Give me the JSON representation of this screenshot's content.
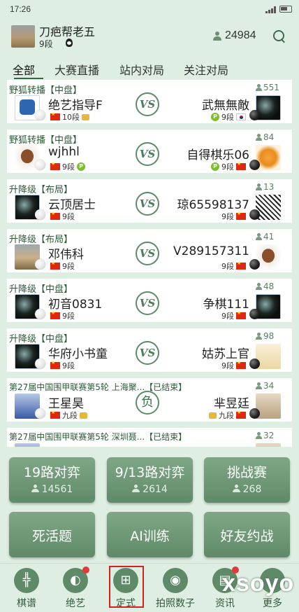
{
  "status_bar": {
    "time": "17:26"
  },
  "header": {
    "username": "刀疤帮老五",
    "rank": "9段",
    "online_count": "24984"
  },
  "tabs": [
    "全部",
    "大赛直播",
    "站内对局",
    "关注对局"
  ],
  "matches": [
    {
      "title": "野狐转播【中盘】",
      "viewers": "551",
      "left_name": "绝艺指导F",
      "left_rank": "10段",
      "right_name": "武無無敵",
      "right_rank": "9段"
    },
    {
      "title": "野狐转播【中盘】",
      "viewers": "84",
      "left_name": "wjhhl",
      "left_rank": "9段",
      "right_name": "自得棋乐06",
      "right_rank": "9段"
    },
    {
      "title": "升降级【布局】",
      "viewers": "13",
      "left_name": "云顶居士",
      "left_rank": "9段",
      "right_name": "琼65598137",
      "right_rank": "9段"
    },
    {
      "title": "升降级【布局】",
      "viewers": "41",
      "left_name": "邓伟科",
      "left_rank": "9段",
      "right_name": "V289157311",
      "right_rank": "9段"
    },
    {
      "title": "升降级【中盘】",
      "viewers": "48",
      "left_name": "初音0831",
      "left_rank": "9段",
      "right_name": "争棋111",
      "right_rank": "9段"
    },
    {
      "title": "升降级【中盘】",
      "viewers": "98",
      "left_name": "华府小书童",
      "left_rank": "9段",
      "right_name": "姑苏上官",
      "right_rank": "9段"
    },
    {
      "title": "第27届中国围甲联赛第5轮 上海聚...【已结束】",
      "viewers": "34",
      "left_name": "王星昊",
      "left_rank": "九段",
      "right_name": "芈昱廷",
      "right_rank": "九段",
      "result": "负"
    },
    {
      "title": "第27届中国围甲联赛第5轮 深圳聂...【已结束】",
      "viewers": "32",
      "left_name": "",
      "left_rank": "",
      "right_name": "",
      "right_rank": ""
    }
  ],
  "vs_label": "VS",
  "buttons": {
    "b19": {
      "label": "19路对弈",
      "count": "14561"
    },
    "b913": {
      "label": "9/13路对弈",
      "count": "2614"
    },
    "challenge": {
      "label": "挑战赛",
      "count": "268"
    },
    "life_death": {
      "label": "死活题"
    },
    "ai_training": {
      "label": "AI训练"
    },
    "friend_match": {
      "label": "好友约战"
    }
  },
  "bottom_nav": [
    "棋谱",
    "绝艺",
    "定式",
    "拍照数子",
    "资讯",
    "更多"
  ],
  "watermark": "xsoyo",
  "colors": {
    "accent": "#5f8a68",
    "background": "#dfeee2",
    "highlight": "#d92020"
  }
}
